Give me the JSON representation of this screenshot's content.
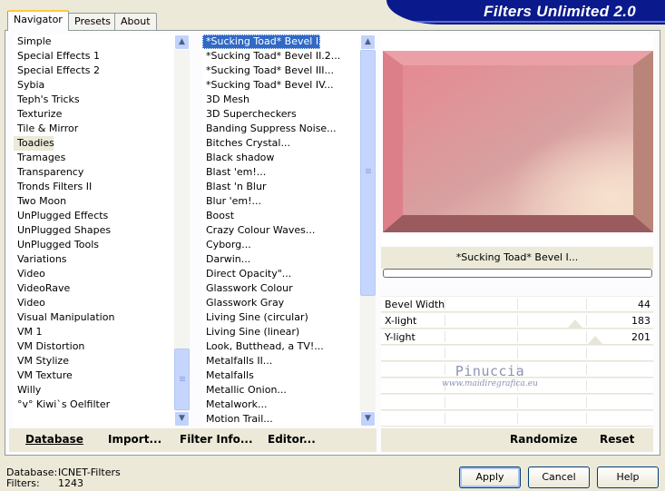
{
  "app": {
    "title": "Filters Unlimited 2.0"
  },
  "tabs": [
    {
      "label": "Navigator",
      "active": true
    },
    {
      "label": "Presets",
      "active": false
    },
    {
      "label": "About",
      "active": false
    }
  ],
  "categories": {
    "items": [
      "Simple",
      "Special Effects 1",
      "Special Effects 2",
      "Sybia",
      "Teph's Tricks",
      "Texturize",
      "Tile & Mirror",
      "Toadies",
      "Tramages",
      "Transparency",
      "Tronds Filters II",
      "Two Moon",
      "UnPlugged Effects",
      "UnPlugged Shapes",
      "UnPlugged Tools",
      "Variations",
      "Video",
      "VideoRave",
      "Video",
      "Visual Manipulation",
      "VM 1",
      "VM Distortion",
      "VM Stylize",
      "VM Texture",
      "Willy",
      "°v° Kiwi`s Oelfilter"
    ],
    "highlighted": "Toadies"
  },
  "filters": {
    "items": [
      "*Sucking Toad*  Bevel I...",
      "*Sucking Toad*  Bevel II.2...",
      "*Sucking Toad*  Bevel III...",
      "*Sucking Toad*  Bevel IV...",
      "3D Mesh",
      "3D Supercheckers",
      "Banding Suppress Noise...",
      "Bitches Crystal...",
      "Black shadow",
      "Blast 'em!...",
      "Blast 'n Blur",
      "Blur 'em!...",
      "Boost",
      "Crazy Colour Waves...",
      "Cyborg...",
      "Darwin...",
      "Direct Opacity\"...",
      "Glasswork Colour",
      "Glasswork Gray",
      "Living Sine (circular)",
      "Living Sine (linear)",
      "Look, Butthead, a TV!...",
      "Metalfalls II...",
      "Metalfalls",
      "Metallic Onion...",
      "Metalwork...",
      "Motion Trail..."
    ],
    "selected": "*Sucking Toad*  Bevel I..."
  },
  "preview": {
    "filter_name": "*Sucking Toad*  Bevel I...",
    "progress": 0
  },
  "params": [
    {
      "label": "Bevel Width",
      "value": "44"
    },
    {
      "label": "X-light",
      "value": "183"
    },
    {
      "label": "Y-light",
      "value": "201"
    }
  ],
  "watermark": {
    "name": "Pinuccia",
    "url": "www.maidiregrafica.eu"
  },
  "toolbar": {
    "database": "Database",
    "import": "Import...",
    "filter_info": "Filter Info...",
    "editor": "Editor...",
    "randomize": "Randomize",
    "reset": "Reset"
  },
  "footer": {
    "database_label": "Database:",
    "database_value": "ICNET-Filters",
    "filters_label": "Filters:",
    "filters_value": "1243"
  },
  "buttons": {
    "apply": "Apply",
    "cancel": "Cancel",
    "help": "Help"
  },
  "icons": {
    "scroll_up": "scroll-up-icon",
    "scroll_down": "scroll-down-icon"
  },
  "colors": {
    "selection": "#316ac5",
    "banner": "#0a1a8c",
    "accent_tab": "#ffc83c"
  }
}
